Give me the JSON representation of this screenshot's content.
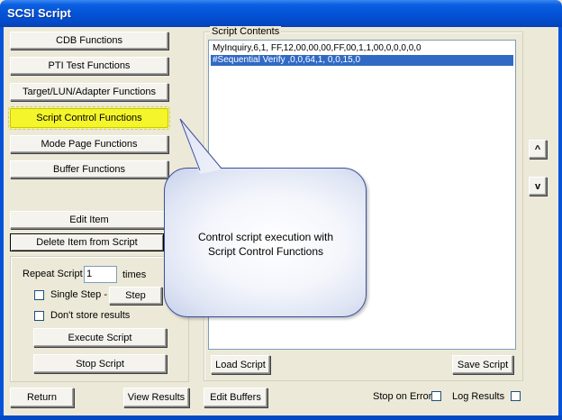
{
  "window": {
    "title": "SCSI Script"
  },
  "function_buttons": {
    "cdb": "CDB Functions",
    "pti": "PTI Test Functions",
    "target": "Target/LUN/Adapter Functions",
    "script_control": "Script Control Functions",
    "mode_page": "Mode Page Functions",
    "buffer": "Buffer Functions"
  },
  "item_buttons": {
    "edit_item": "Edit Item",
    "delete_item": "Delete Item from Script"
  },
  "repeat": {
    "label": "Repeat Script",
    "value": "1",
    "times_label": "times",
    "single_step_label": "Single Step -",
    "step_button": "Step",
    "dont_store_label": "Don't store results",
    "execute_button": "Execute Script",
    "stop_button": "Stop Script"
  },
  "script_contents": {
    "label": "Script Contents",
    "items": [
      {
        "text": "MyInquiry,6,1,  FF,12,00,00,00,FF,00,1,1,00,0,0,0,0,0",
        "selected": false
      },
      {
        "text": "#Sequential Verify ,0,0,64,1,  0,0,15,0",
        "selected": true
      }
    ],
    "load_button": "Load Script",
    "save_button": "Save Script",
    "up_button": "^",
    "down_button": "v"
  },
  "bottom": {
    "return_button": "Return",
    "view_results_button": "View Results",
    "edit_buffers_button": "Edit Buffers",
    "stop_on_error_label": "Stop on Error",
    "log_results_label": "Log Results"
  },
  "callout": {
    "line1": "Control script execution with",
    "line2": "Script Control Functions"
  },
  "colors": {
    "title_bar": "#0553d8",
    "highlight": "#f4f52a",
    "selection": "#316ac5",
    "dialog_bg": "#ece9d8"
  }
}
